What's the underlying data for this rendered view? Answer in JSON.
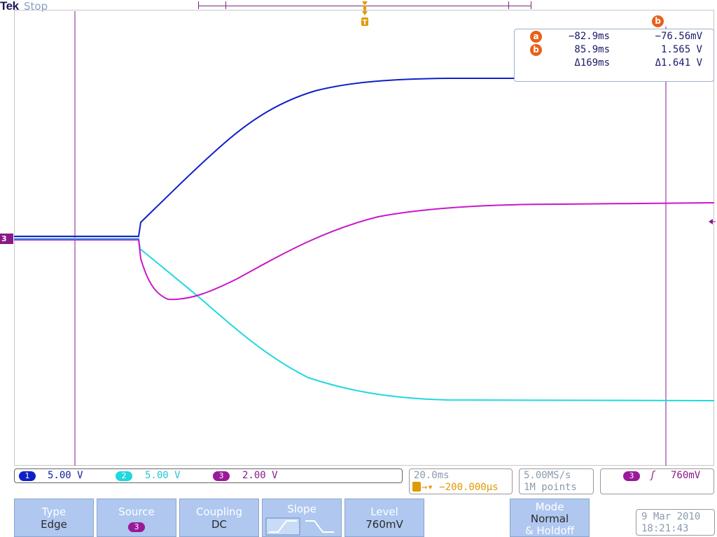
{
  "header": {
    "brand": "Tek",
    "run_state": "Stop"
  },
  "cursors": {
    "a": {
      "label": "a",
      "time": "−82.9ms",
      "value": "−76.56mV"
    },
    "b": {
      "label": "b",
      "time": "85.9ms",
      "value": "1.565 V"
    },
    "delta": {
      "time": "Δ169ms",
      "value": "Δ1.641 V"
    }
  },
  "markers": {
    "trigger_pos_label": "T",
    "ch3_marker": "3",
    "cursor_b_marker": "b"
  },
  "channels": [
    {
      "num": "1",
      "scale": "5.00 V",
      "color": "#1020d0"
    },
    {
      "num": "2",
      "scale": "5.00 V",
      "color": "#20d8e0"
    },
    {
      "num": "3",
      "scale": "2.00 V",
      "color": "#9a1a9a"
    }
  ],
  "timebase": {
    "scale": "20.0ms",
    "position": "→▾ −200.000µs",
    "pos_color": "#e09a00"
  },
  "sampling": {
    "rate": "5.00MS/s",
    "record": "1M points"
  },
  "trigger": {
    "source": "3",
    "slope_symbol": "ʃ",
    "level": "760mV"
  },
  "softkeys": {
    "type": {
      "label": "Type",
      "value": "Edge"
    },
    "source": {
      "label": "Source",
      "value": "3"
    },
    "coupling": {
      "label": "Coupling",
      "value": "DC"
    },
    "slope": {
      "label": "Slope"
    },
    "level": {
      "label": "Level",
      "value": "760mV"
    },
    "mode": {
      "label": "Mode",
      "value1": "Normal",
      "value2": "& Holdoff"
    }
  },
  "datetime": {
    "date": "9 Mar 2010",
    "time": "18:21:43"
  },
  "colors": {
    "ch1": "#1020c8",
    "ch2": "#20d8e0",
    "ch3": "#c818c8",
    "cursor": "#8a1a8a",
    "accent": "#e8601a",
    "softkey": "#b0c8f0"
  }
}
